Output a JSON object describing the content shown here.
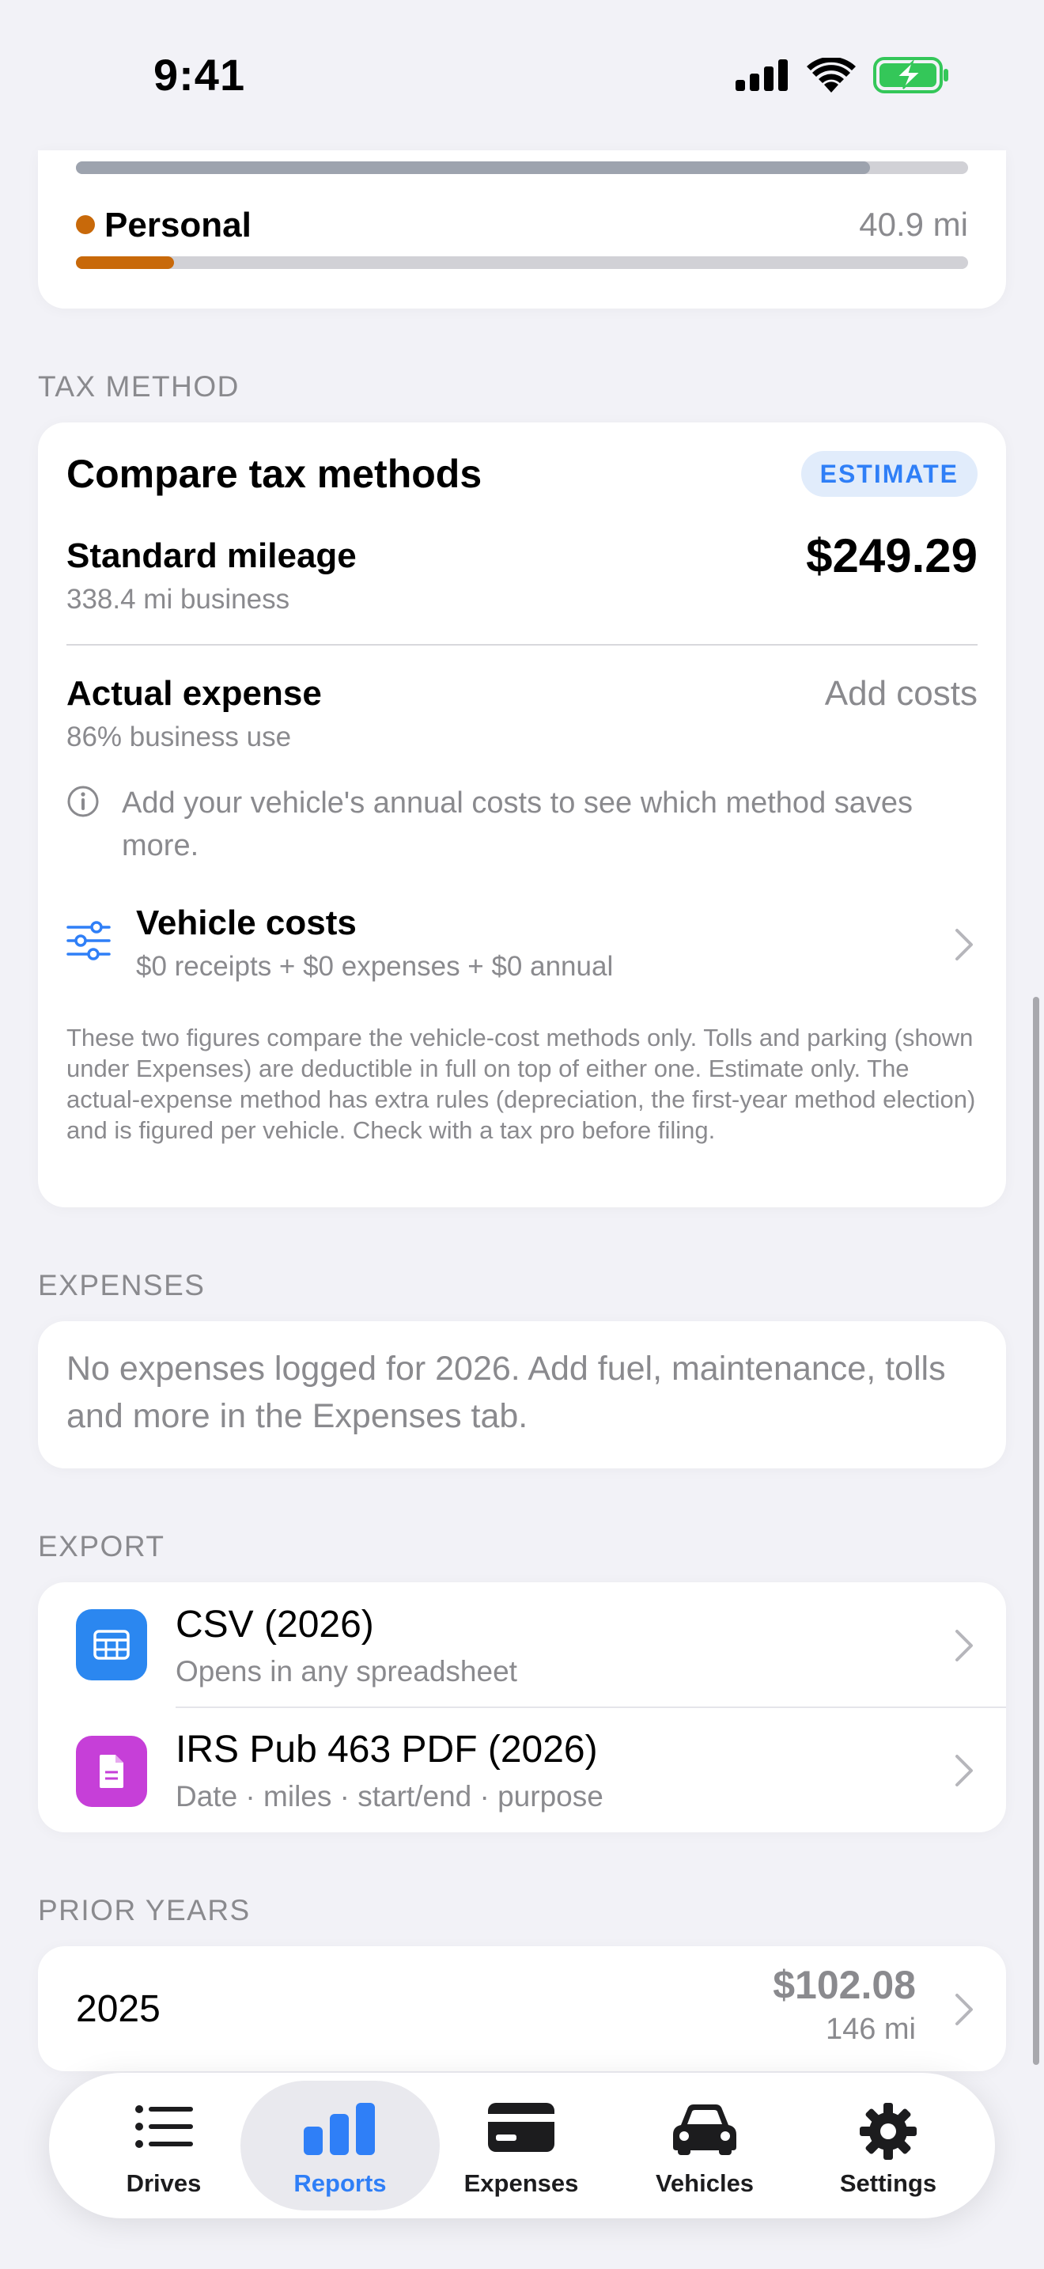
{
  "status_bar": {
    "time": "9:41",
    "battery_level": 1.0
  },
  "mileage_breakdown": {
    "business_bar_fill": 0.89,
    "personal": {
      "label": "Personal",
      "value": "40.9 mi",
      "fill": 0.11,
      "color": "#c8690a"
    }
  },
  "tax_method": {
    "section_title": "TAX METHOD",
    "card_title": "Compare tax methods",
    "badge": "ESTIMATE",
    "standard": {
      "title": "Standard mileage",
      "subtitle": "338.4 mi business",
      "amount": "$249.29"
    },
    "actual": {
      "title": "Actual expense",
      "subtitle": "86% business use",
      "action": "Add costs"
    },
    "info": "Add your vehicle's annual costs to see which method saves more.",
    "vehicle_costs": {
      "title": "Vehicle costs",
      "subtitle": "$0 receipts + $0 expenses + $0 annual"
    },
    "disclaimer": "These two figures compare the vehicle-cost methods only. Tolls and parking (shown under Expenses) are deductible in full on top of either one. Estimate only. The actual-expense method has extra rules (depreciation, the first-year method election) and is figured per vehicle. Check with a tax pro before filing."
  },
  "expenses": {
    "section_title": "EXPENSES",
    "empty_message": "No expenses logged for 2026. Add fuel, maintenance, tolls and more in the Expenses tab."
  },
  "export": {
    "section_title": "EXPORT",
    "items": [
      {
        "title": "CSV (2026)",
        "subtitle": "Opens in any spreadsheet",
        "icon": "table-icon",
        "color": "#2b87f0"
      },
      {
        "title": "IRS Pub 463 PDF (2026)",
        "subtitle": "Date · miles · start/end · purpose",
        "icon": "document-icon",
        "color": "#c63fd8"
      }
    ]
  },
  "prior_years": {
    "section_title": "PRIOR YEARS",
    "items": [
      {
        "year": "2025",
        "amount": "$102.08",
        "miles": "146 mi"
      }
    ]
  },
  "tab_bar": {
    "tabs": [
      {
        "label": "Drives",
        "icon": "list-icon"
      },
      {
        "label": "Reports",
        "icon": "bar-chart-icon",
        "active": true
      },
      {
        "label": "Expenses",
        "icon": "credit-card-icon"
      },
      {
        "label": "Vehicles",
        "icon": "car-icon"
      },
      {
        "label": "Settings",
        "icon": "gear-icon"
      }
    ],
    "accent_color": "#2f7ff7"
  }
}
